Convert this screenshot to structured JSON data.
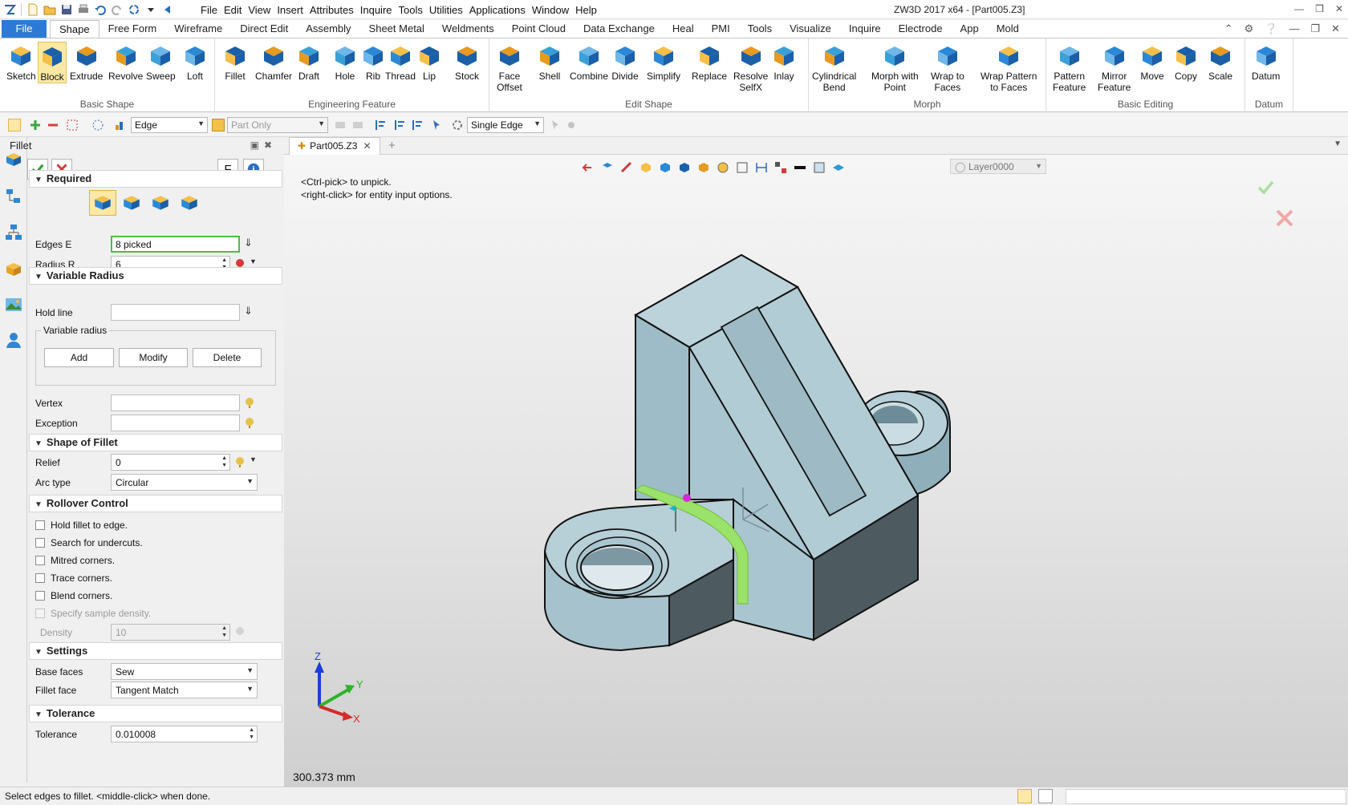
{
  "app": {
    "title": "ZW3D 2017  x64 - [Part005.Z3]",
    "menu": [
      "File",
      "Edit",
      "View",
      "Insert",
      "Attributes",
      "Inquire",
      "Tools",
      "Utilities",
      "Applications",
      "Window",
      "Help"
    ]
  },
  "ribbon": {
    "file_tab": "File",
    "tabs": [
      "Shape",
      "Free Form",
      "Wireframe",
      "Direct Edit",
      "Assembly",
      "Sheet Metal",
      "Weldments",
      "Point Cloud",
      "Data Exchange",
      "Heal",
      "PMI",
      "Tools",
      "Visualize",
      "Inquire",
      "Electrode",
      "App",
      "Mold"
    ],
    "active_tab": "Shape",
    "groups": [
      {
        "label": "Basic Shape",
        "buttons": [
          "Sketch",
          "Block",
          "Extrude",
          "Revolve",
          "Sweep",
          "Loft"
        ]
      },
      {
        "label": "Engineering Feature",
        "buttons": [
          "Fillet",
          "Chamfer",
          "Draft",
          "Hole",
          "Rib",
          "Thread",
          "Lip",
          "Stock"
        ]
      },
      {
        "label": "Edit Shape",
        "buttons": [
          "Face\nOffset",
          "Shell",
          "Combine",
          "Divide",
          "Simplify",
          "Replace",
          "Resolve\nSelfX",
          "Inlay"
        ]
      },
      {
        "label": "Morph",
        "buttons": [
          "Cylindrical\nBend",
          "Morph with\nPoint",
          "Wrap to\nFaces",
          "Wrap Pattern\nto Faces"
        ]
      },
      {
        "label": "Basic Editing",
        "buttons": [
          "Pattern\nFeature",
          "Mirror\nFeature",
          "Move",
          "Copy",
          "Scale"
        ]
      },
      {
        "label": "Datum",
        "buttons": [
          "Datum"
        ]
      }
    ]
  },
  "toolbar": {
    "filter": "Edge",
    "scope": "Part Only",
    "pick_mode": "Single Edge"
  },
  "panel": {
    "title": "Fillet",
    "f_button": "F",
    "info_button": "i",
    "sections": {
      "required": "Required",
      "variable_radius": "Variable Radius",
      "shape_of_fillet": "Shape of Fillet",
      "rollover_control": "Rollover Control",
      "settings": "Settings",
      "tolerance": "Tolerance"
    },
    "edges_label": "Edges E",
    "edges_value": "8 picked",
    "radius_label": "Radius R",
    "radius_value": "6",
    "hold_line_label": "Hold line",
    "variable_radius_group": "Variable radius",
    "add": "Add",
    "modify": "Modify",
    "delete": "Delete",
    "vertex_label": "Vertex",
    "exception_label": "Exception",
    "relief_label": "Relief",
    "relief_value": "0",
    "arc_type_label": "Arc type",
    "arc_type_value": "Circular",
    "rollover": [
      "Hold fillet to edge.",
      "Search for undercuts.",
      "Mitred corners.",
      "Trace corners.",
      "Blend corners.",
      "Specify sample density."
    ],
    "density_label": "Density",
    "density_value": "10",
    "base_faces_label": "Base faces",
    "base_faces_value": "Sew",
    "fillet_face_label": "Fillet face",
    "fillet_face_value": "Tangent Match",
    "tolerance_label": "Tolerance",
    "tolerance_value": "0.010008"
  },
  "document": {
    "tab": "Part005.Z3",
    "layer": "Layer0000",
    "hint_line1": "<Ctrl-pick> to unpick.",
    "hint_line2": "<right-click> for entity input options.",
    "measure": "300.373 mm",
    "axis_labels": {
      "x": "X",
      "y": "Y",
      "z": "Z"
    }
  },
  "status": {
    "text": "Select edges to fillet.  <middle-click> when done."
  },
  "colors": {
    "accent": "#2b7bd6",
    "model_face": "#a9c5cf",
    "model_dark": "#4d5a60",
    "fillet_highlight": "#9be26a",
    "ok_green": "#2fa52a",
    "cancel_red": "#d63a3a"
  }
}
